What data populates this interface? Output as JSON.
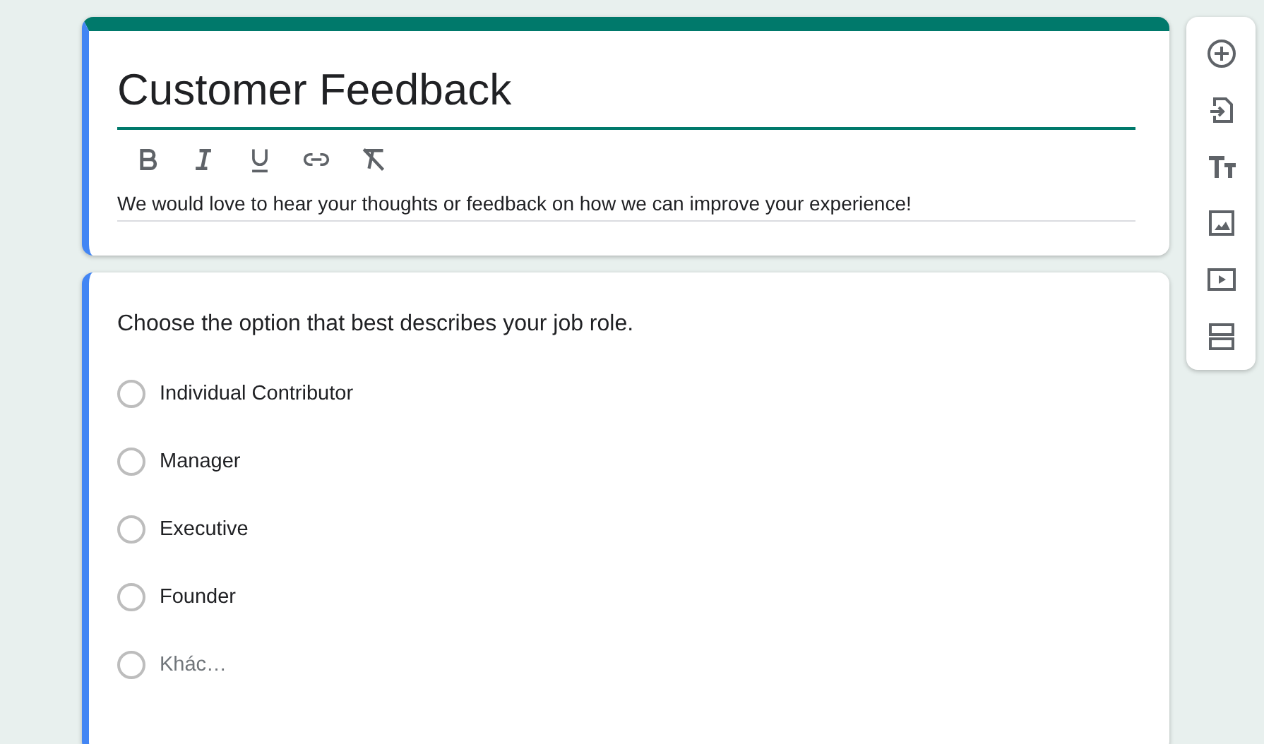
{
  "form_header": {
    "title": "Customer Feedback",
    "toolbar": [
      {
        "kind": "bold"
      },
      {
        "kind": "italic"
      },
      {
        "kind": "underline"
      },
      {
        "kind": "link"
      },
      {
        "kind": "clear"
      }
    ],
    "description": "We would love to hear your thoughts or feedback on how we can improve your experience!"
  },
  "question": {
    "prompt": "Choose the option that best describes your job role.",
    "options": [
      {
        "kind": "option",
        "label": "Individual Contributor",
        "selected": false
      },
      {
        "kind": "option",
        "label": "Manager",
        "selected": false
      },
      {
        "kind": "option",
        "label": "Executive",
        "selected": false
      },
      {
        "kind": "option",
        "label": "Founder",
        "selected": false
      },
      {
        "kind": "other",
        "label": "Khác…",
        "selected": false
      }
    ]
  },
  "side_toolbar": [
    {
      "kind": "add"
    },
    {
      "kind": "import"
    },
    {
      "kind": "title"
    },
    {
      "kind": "image"
    },
    {
      "kind": "video"
    },
    {
      "kind": "section"
    }
  ]
}
